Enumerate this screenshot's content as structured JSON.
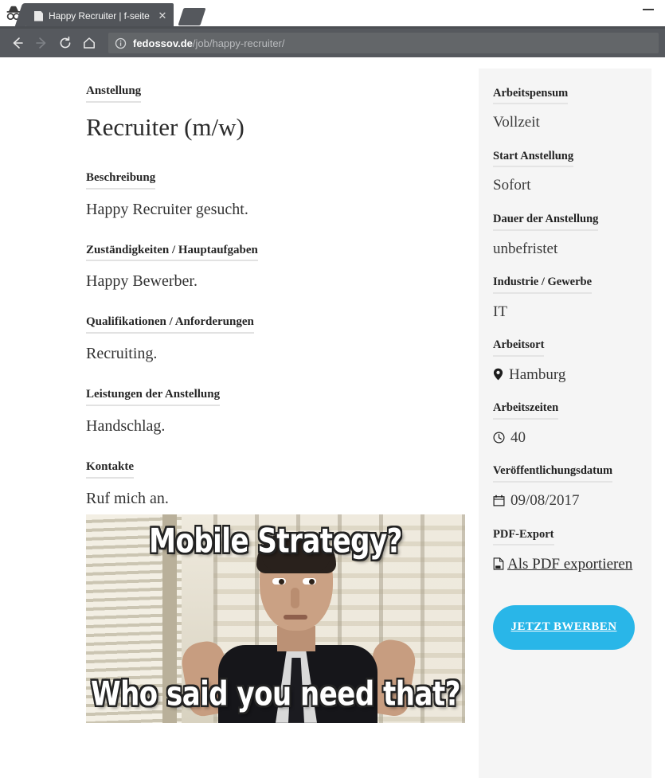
{
  "browser": {
    "incognito_icon": "incognito-icon",
    "tab": {
      "title": "Happy Recruiter | f-seite",
      "favicon": "page-icon",
      "close_label": "✕"
    },
    "new_tab_label": "",
    "minimize_label": "",
    "nav": {
      "back_icon": "back-arrow-icon",
      "forward_icon": "forward-arrow-icon",
      "reload_icon": "reload-icon",
      "home_icon": "home-icon"
    },
    "omnibox": {
      "info_icon": "info-circle-icon",
      "host": "fedossov.de",
      "path": "/job/happy-recruiter/",
      "full_url": "fedossov.de/job/happy-recruiter/"
    }
  },
  "main": {
    "employment_label": "Anstellung",
    "job_title": "Recruiter (m/w)",
    "sections": [
      {
        "heading": "Beschreibung",
        "body": "Happy Recruiter gesucht."
      },
      {
        "heading": "Zuständigkeiten / Hauptaufgaben",
        "body": "Happy Bewerber."
      },
      {
        "heading": "Qualifikationen / Anforderungen",
        "body": "Recruiting."
      },
      {
        "heading": "Leistungen der Anstellung",
        "body": "Handschlag."
      },
      {
        "heading": "Kontakte",
        "body": "Ruf mich an."
      }
    ],
    "meme": {
      "top_text": "Mobile Strategy?",
      "bottom_text": "Who said you need that?",
      "alt": "Don Draper meme image"
    }
  },
  "sidebar": {
    "blocks": [
      {
        "heading": "Arbeitspensum",
        "value": "Vollzeit",
        "icon": ""
      },
      {
        "heading": "Start Anstellung",
        "value": "Sofort",
        "icon": ""
      },
      {
        "heading": "Dauer der Anstellung",
        "value": "unbefristet",
        "icon": ""
      },
      {
        "heading": "Industrie / Gewerbe",
        "value": "IT",
        "icon": ""
      },
      {
        "heading": "Arbeitsort",
        "value": "Hamburg",
        "icon": "map-pin-icon"
      },
      {
        "heading": "Arbeitszeiten",
        "value": "40",
        "icon": "clock-icon"
      },
      {
        "heading": "Veröffentlichungsdatum",
        "value": "09/08/2017",
        "icon": "calendar-icon"
      }
    ],
    "pdf": {
      "heading": "PDF-Export",
      "link_text": "Als PDF exportieren",
      "icon": "pdf-file-icon"
    },
    "apply_button": {
      "label": "JETZT BWERBEN",
      "color": "#29b6e8"
    }
  },
  "colors": {
    "chrome_bg": "#56595e",
    "tab_active": "#52555a",
    "sidebar_bg": "#f5f5f5",
    "accent": "#29b6e8",
    "text": "#333333",
    "rule": "#e3e3e3"
  }
}
